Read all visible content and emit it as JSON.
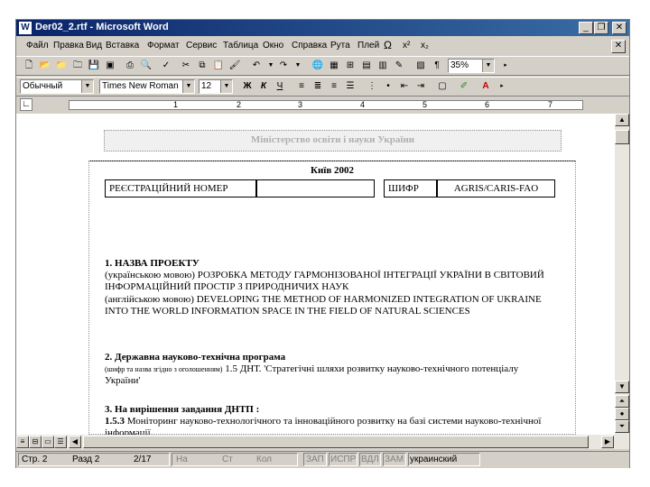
{
  "window": {
    "title": "Der02_2.rtf - Microsoft Word",
    "app_icon": "W"
  },
  "title_buttons": {
    "minimize": "_",
    "restore": "❐",
    "close": "✕"
  },
  "menu": {
    "items": [
      "Файл",
      "Правка",
      "Вид",
      "Вставка",
      "Формат",
      "Сервис",
      "Таблица",
      "Окно",
      "Справка",
      "Рута",
      "Плей"
    ],
    "extras": [
      "Ω",
      "x²",
      "x₂"
    ],
    "doc_close": "✕"
  },
  "toolbar_standard": {
    "icons": [
      "new-icon",
      "open-icon",
      "open-folder-icon",
      "folder-icon",
      "save-icon",
      "permission-icon",
      "print-icon",
      "print-preview-icon",
      "spelling-icon",
      "cut-icon",
      "copy-icon",
      "paste-icon",
      "format-painter-icon",
      "undo-icon",
      "redo-icon",
      "hyperlink-icon",
      "tables-borders-icon",
      "insert-table-icon",
      "insert-excel-icon",
      "columns-icon",
      "drawing-icon",
      "document-map-icon",
      "show-hide-icon"
    ],
    "zoom": "35%"
  },
  "toolbar_format": {
    "style": "Обычный",
    "font": "Times New Roman",
    "size": "12",
    "bold": "Ж",
    "italic": "К",
    "underline": "Ч"
  },
  "ruler": {
    "numbers": [
      "1",
      "2",
      "3",
      "4",
      "5",
      "6",
      "7"
    ]
  },
  "document": {
    "ministry": "Міністерство освіти і науки України",
    "city_year": "Київ   2002",
    "reg_label": "РЕЄСТРАЦІЙНИЙ НОМЕР",
    "reg_value": "",
    "cipher_label": "ШИФР",
    "cipher_value": "AGRIS/CARIS-FAO",
    "s1_title": "1. НАЗВА ПРОЕКТУ",
    "s1_ua_prefix": "(українською мовою)",
    "s1_ua_text": "РОЗРОБКА МЕТОДУ ГАРМОНІЗОВАНОЇ ІНТЕГРАЦІЇ УКРАЇНИ В СВІТОВИЙ ІНФОРМАЦІЙНИЙ ПРОСТІР З ПРИРОДНИЧИХ НАУК",
    "s1_en_prefix": "(англійською мовою)",
    "s1_en_text": "DEVELOPING THE METHOD OF HARMONIZED INTEGRATION OF UKRAINE INTO THE WORLD INFORMATION SPACE IN THE FIELD OF NATURAL SCIENCES",
    "s2_title": "2. Державна науково-технічна програма",
    "s2_prefix": "(шифр та назва згідно з оголошенням)",
    "s2_text": "1.5 ДНТ. 'Стратегічні шляхи розвитку науково-технічного потенціалу України'",
    "s3_title": "3. На вирішення завдання ДНТП :",
    "s3_code": "1.5.3",
    "s3_text": "Моніторинг науково-технологічного та інноваційного розвитку на базі системи науково-технічної інформації."
  },
  "statusbar": {
    "page": "Стр. 2",
    "section": "Разд 2",
    "pages": "2/17",
    "at": "На",
    "line": "Ст",
    "col": "Кол",
    "rec": "ЗАП",
    "trk": "ИСПР",
    "ext": "ВДЛ",
    "ovr": "ЗАМ",
    "lang": "украинский"
  }
}
